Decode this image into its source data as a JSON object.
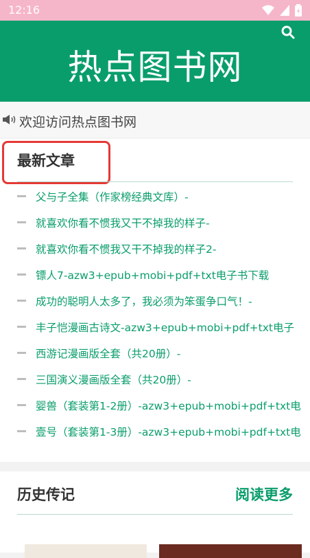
{
  "status": {
    "time": "12:16"
  },
  "header": {
    "title": "热点图书网"
  },
  "notice": {
    "text": "欢迎访问热点图书网"
  },
  "latest": {
    "title": "最新文章",
    "items": [
      "父与子全集（作家榜经典文库）-",
      "就喜欢你看不惯我又干不掉我的样子-",
      "就喜欢你看不惯我又干不掉我的样子2-",
      "镖人7-azw3+epub+mobi+pdf+txt电子书下载",
      "成功的聪明人太多了，我必须为笨蛋争口气！-",
      "丰子恺漫画古诗文-azw3+epub+mobi+pdf+txt电子",
      "西游记漫画版全套（共20册）-",
      "三国演义漫画版全套（共20册）-",
      "婴兽（套装第1-2册）-azw3+epub+mobi+pdf+txt电",
      "壹号（套装第1-3册）-azw3+epub+mobi+pdf+txt电"
    ]
  },
  "history": {
    "title": "历史传记",
    "more": "阅读更多"
  },
  "colors": {
    "brand": "#0a9d6c",
    "status_bar": "#f6b6c9",
    "highlight": "#e53935"
  }
}
